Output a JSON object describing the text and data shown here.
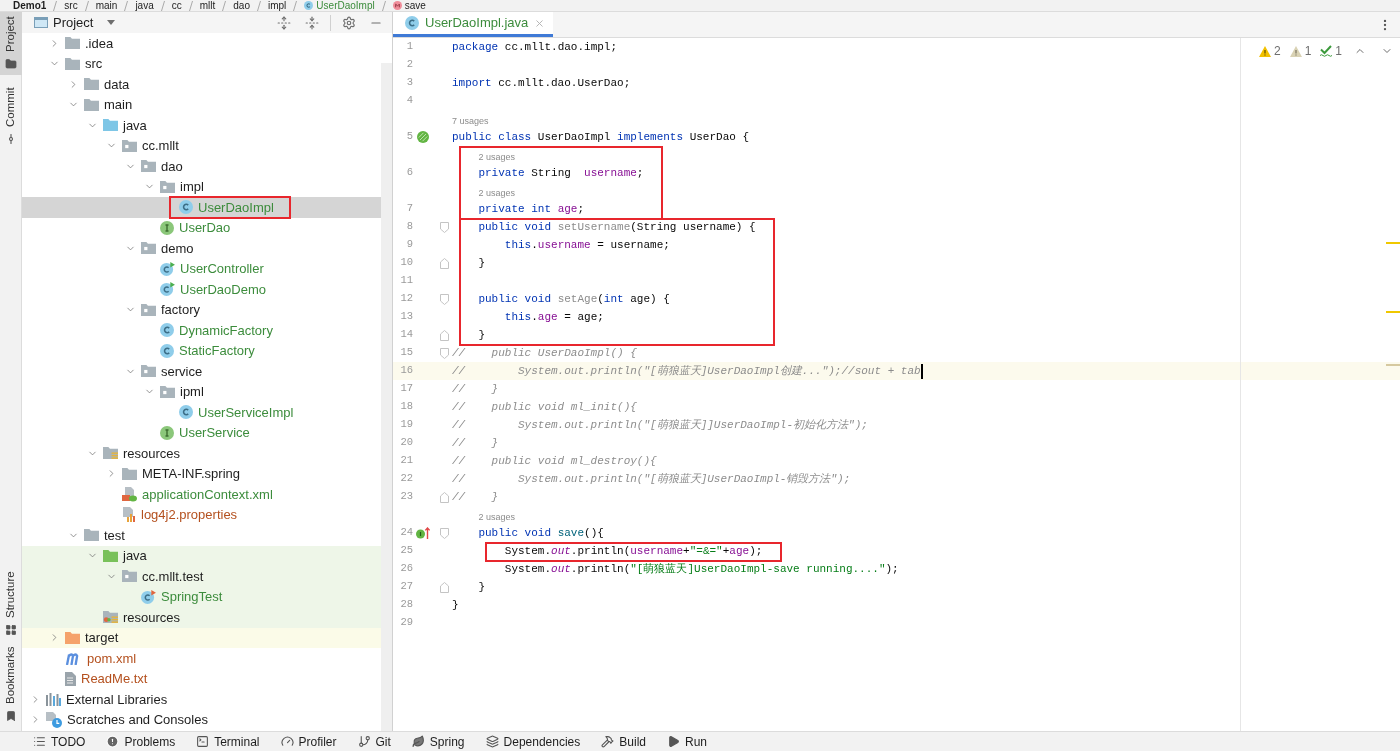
{
  "breadcrumb": [
    {
      "label": "Demo1",
      "kind": "project"
    },
    {
      "label": "src",
      "kind": "folder"
    },
    {
      "label": "main",
      "kind": "folder"
    },
    {
      "label": "java",
      "kind": "folder"
    },
    {
      "label": "cc",
      "kind": "folder"
    },
    {
      "label": "mllt",
      "kind": "folder"
    },
    {
      "label": "dao",
      "kind": "folder"
    },
    {
      "label": "impl",
      "kind": "folder"
    },
    {
      "label": "UserDaoImpl",
      "kind": "class",
      "color": "#3c8c3c"
    },
    {
      "label": "save",
      "kind": "method"
    }
  ],
  "tool_strip": {
    "top": [
      {
        "label": "Project",
        "kind": "folder",
        "selected": true
      },
      {
        "label": "Commit",
        "kind": "commit",
        "selected": false
      }
    ],
    "bottom": [
      {
        "label": "Structure",
        "kind": "structure",
        "selected": false
      },
      {
        "label": "Bookmarks",
        "kind": "bookmark",
        "selected": false
      }
    ]
  },
  "project_panel": {
    "title": "Project",
    "project_items": [
      {
        "label": ".idea",
        "kind": "folder",
        "expanded": false,
        "selected": false
      },
      {
        "label": "src",
        "kind": "folder",
        "expanded": true,
        "selected": false,
        "children": [
          {
            "label": "data",
            "kind": "folder",
            "expanded": false,
            "selected": false
          },
          {
            "label": "main",
            "kind": "folder",
            "expanded": true,
            "selected": false,
            "children": [
              {
                "label": "java",
                "kind": "source-folder",
                "expanded": true,
                "selected": false,
                "children": [
                  {
                    "label": "cc.mllt",
                    "kind": "package",
                    "expanded": true,
                    "selected": false,
                    "children": [
                      {
                        "label": "dao",
                        "kind": "package",
                        "expanded": true,
                        "selected": false,
                        "children": [
                          {
                            "label": "impl",
                            "kind": "package",
                            "expanded": true,
                            "selected": false,
                            "children": [
                              {
                                "label": "UserDaoImpl",
                                "kind": "class",
                                "color": "#3c8c3c",
                                "selected": true,
                                "framed": true
                              }
                            ]
                          },
                          {
                            "label": "UserDao",
                            "kind": "interface",
                            "color": "#3c8c3c",
                            "selected": false
                          }
                        ]
                      },
                      {
                        "label": "demo",
                        "kind": "package",
                        "expanded": true,
                        "selected": false,
                        "children": [
                          {
                            "label": "UserController",
                            "kind": "runnable-class",
                            "color": "#3c8c3c",
                            "selected": false
                          },
                          {
                            "label": "UserDaoDemo",
                            "kind": "runnable-class",
                            "color": "#3c8c3c",
                            "selected": false
                          }
                        ]
                      },
                      {
                        "label": "factory",
                        "kind": "package",
                        "expanded": true,
                        "selected": false,
                        "children": [
                          {
                            "label": "DynamicFactory",
                            "kind": "class",
                            "color": "#3c8c3c",
                            "selected": false
                          },
                          {
                            "label": "StaticFactory",
                            "kind": "class",
                            "color": "#3c8c3c",
                            "selected": false
                          }
                        ]
                      },
                      {
                        "label": "service",
                        "kind": "package",
                        "expanded": true,
                        "selected": false,
                        "children": [
                          {
                            "label": "ipml",
                            "kind": "package",
                            "expanded": true,
                            "selected": false,
                            "children": [
                              {
                                "label": "UserServiceImpl",
                                "kind": "class",
                                "color": "#3c8c3c",
                                "selected": false
                              }
                            ]
                          },
                          {
                            "label": "UserService",
                            "kind": "interface",
                            "color": "#3c8c3c",
                            "selected": false
                          }
                        ]
                      }
                    ]
                  }
                ]
              },
              {
                "label": "resources",
                "kind": "resources-folder",
                "expanded": true,
                "selected": false,
                "children": [
                  {
                    "label": "META-INF.spring",
                    "kind": "folder",
                    "expanded": false,
                    "selected": false
                  },
                  {
                    "label": "applicationContext.xml",
                    "kind": "spring-xml",
                    "color": "#3c8c3c",
                    "selected": false
                  },
                  {
                    "label": "log4j2.properties",
                    "kind": "properties",
                    "color": "#b4501e",
                    "selected": false
                  }
                ]
              }
            ]
          },
          {
            "label": "test",
            "kind": "folder",
            "expanded": true,
            "selected": false,
            "children": [
              {
                "label": "java",
                "kind": "test-source-folder",
                "expanded": true,
                "test_source": true,
                "selected": false,
                "children": [
                  {
                    "label": "cc.mllt.test",
                    "kind": "package",
                    "expanded": true,
                    "test_source": true,
                    "selected": false,
                    "children": [
                      {
                        "label": "SpringTest",
                        "kind": "test-class",
                        "color": "#3c8c3c",
                        "test_source": true,
                        "selected": false
                      }
                    ]
                  }
                ]
              },
              {
                "label": "resources",
                "kind": "test-resources-folder",
                "test_source": true,
                "selected": false
              }
            ]
          }
        ]
      },
      {
        "label": "target",
        "kind": "excluded-folder",
        "expanded": false,
        "excluded": true,
        "selected": false
      },
      {
        "label": "pom.xml",
        "kind": "maven",
        "color": "#b4501e",
        "selected": false
      },
      {
        "label": "ReadMe.txt",
        "kind": "text-file",
        "color": "#b4501e",
        "selected": false
      }
    ],
    "global_items": [
      {
        "label": "External Libraries",
        "kind": "libraries",
        "expanded": false,
        "selected": false
      },
      {
        "label": "Scratches and Consoles",
        "kind": "scratches",
        "expanded": false,
        "selected": false
      }
    ]
  },
  "editor": {
    "tabs": [
      {
        "label": "UserDaoImpl.java",
        "kind": "class",
        "color": "#3c8c3c",
        "selected": true
      }
    ],
    "inspections": [
      {
        "kind": "warning",
        "count": "2"
      },
      {
        "kind": "weak-warning",
        "count": "1"
      },
      {
        "kind": "typo",
        "count": "1"
      }
    ],
    "code": {
      "blocks": [
        {
          "framed": false,
          "lines": [
            {
              "number": "1",
              "current": false,
              "tokens": [
                {
                  "kind": "kw",
                  "text": "package"
                },
                {
                  "kind": "plain",
                  "text": " cc.mllt.dao.impl;"
                }
              ]
            },
            {
              "number": "2",
              "current": false
            },
            {
              "number": "3",
              "current": false,
              "tokens": [
                {
                  "kind": "kw",
                  "text": "import"
                },
                {
                  "kind": "plain",
                  "text": " cc.mllt.dao.UserDao;"
                }
              ]
            },
            {
              "number": "4",
              "current": false
            },
            {
              "number": "5",
              "current": false,
              "usages_hint": "7 usages",
              "gutter_marker": {
                "kind": "bean"
              },
              "tokens": [
                {
                  "kind": "kw",
                  "text": "public"
                },
                {
                  "kind": "kw",
                  "text": " class"
                },
                {
                  "kind": "plain",
                  "text": " UserDaoImpl "
                },
                {
                  "kind": "kw",
                  "text": "implements"
                },
                {
                  "kind": "plain",
                  "text": " UserDao {"
                }
              ]
            }
          ]
        },
        {
          "framed": true,
          "lines": [
            {
              "number": "6",
              "current": false,
              "usages_hint": "2 usages",
              "tokens": [
                {
                  "kind": "kw",
                  "text": "    private"
                },
                {
                  "kind": "plain",
                  "text": " String  "
                },
                {
                  "kind": "field",
                  "text": "username"
                },
                {
                  "kind": "plain",
                  "text": ";"
                }
              ]
            },
            {
              "number": "7",
              "current": false,
              "usages_hint": "2 usages",
              "tokens": [
                {
                  "kind": "kw",
                  "text": "    private"
                },
                {
                  "kind": "kw",
                  "text": " int"
                },
                {
                  "kind": "field",
                  "text": " age"
                },
                {
                  "kind": "plain",
                  "text": ";"
                }
              ]
            }
          ]
        },
        {
          "framed": true,
          "lines": [
            {
              "number": "8",
              "current": false,
              "fold_start": true,
              "tokens": [
                {
                  "kind": "kw",
                  "text": "    public"
                },
                {
                  "kind": "kw",
                  "text": " void"
                },
                {
                  "kind": "unused",
                  "text": " setUsername"
                },
                {
                  "kind": "plain",
                  "text": "(String username) {"
                }
              ]
            },
            {
              "number": "9",
              "current": false,
              "tokens": [
                {
                  "kind": "kw",
                  "text": "        this"
                },
                {
                  "kind": "plain",
                  "text": "."
                },
                {
                  "kind": "field",
                  "text": "username"
                },
                {
                  "kind": "plain",
                  "text": " = username;"
                }
              ]
            },
            {
              "number": "10",
              "current": false,
              "fold_end": true,
              "tokens": [
                {
                  "kind": "plain",
                  "text": "    }"
                }
              ]
            },
            {
              "number": "11",
              "current": false
            },
            {
              "number": "12",
              "current": false,
              "fold_start": true,
              "tokens": [
                {
                  "kind": "kw",
                  "text": "    public"
                },
                {
                  "kind": "kw",
                  "text": " void"
                },
                {
                  "kind": "unused",
                  "text": " setAge"
                },
                {
                  "kind": "plain",
                  "text": "("
                },
                {
                  "kind": "kw",
                  "text": "int"
                },
                {
                  "kind": "plain",
                  "text": " age) {"
                }
              ]
            },
            {
              "number": "13",
              "current": false,
              "tokens": [
                {
                  "kind": "kw",
                  "text": "        this"
                },
                {
                  "kind": "plain",
                  "text": "."
                },
                {
                  "kind": "field",
                  "text": "age"
                },
                {
                  "kind": "plain",
                  "text": " = age;"
                }
              ]
            },
            {
              "number": "14",
              "current": false,
              "fold_end": true,
              "tokens": [
                {
                  "kind": "plain",
                  "text": "    }"
                }
              ]
            }
          ]
        },
        {
          "framed": false,
          "lines": [
            {
              "number": "15",
              "current": false,
              "fold_start": true,
              "tokens": [
                {
                  "kind": "comment",
                  "text": "//    public UserDaoImpl() {"
                }
              ]
            },
            {
              "number": "16",
              "current": true,
              "tokens": [
                {
                  "kind": "comment",
                  "text": "//        System.out.println(\"[萌狼蓝天]UserDaoImpl创建...\");//sout + tab"
                }
              ]
            },
            {
              "number": "17",
              "current": false,
              "tokens": [
                {
                  "kind": "comment",
                  "text": "//    }"
                }
              ]
            },
            {
              "number": "18",
              "current": false,
              "tokens": [
                {
                  "kind": "comment",
                  "text": "//    public void ml_init(){"
                }
              ]
            },
            {
              "number": "19",
              "current": false,
              "tokens": [
                {
                  "kind": "comment",
                  "text": "//        System.out.println(\"[萌狼蓝天]]UserDaoImpl-初始化方法\");"
                }
              ]
            },
            {
              "number": "20",
              "current": false,
              "tokens": [
                {
                  "kind": "comment",
                  "text": "//    }"
                }
              ]
            },
            {
              "number": "21",
              "current": false,
              "tokens": [
                {
                  "kind": "comment",
                  "text": "//    public void ml_destroy(){"
                }
              ]
            },
            {
              "number": "22",
              "current": false,
              "tokens": [
                {
                  "kind": "comment",
                  "text": "//        System.out.println(\"[萌狼蓝天]UserDaoImpl-销毁方法\");"
                }
              ]
            },
            {
              "number": "23",
              "current": false,
              "fold_end": true,
              "tokens": [
                {
                  "kind": "comment",
                  "text": "//    }"
                }
              ]
            },
            {
              "number": "24",
              "current": false,
              "usages_hint": "2 usages",
              "gutter_marker": {
                "kind": "implements"
              },
              "fold_start": true,
              "tokens": [
                {
                  "kind": "kw",
                  "text": "    public"
                },
                {
                  "kind": "kw",
                  "text": " void"
                },
                {
                  "kind": "method",
                  "text": " save"
                },
                {
                  "kind": "plain",
                  "text": "(){"
                }
              ]
            }
          ]
        },
        {
          "framed": true,
          "lines": [
            {
              "number": "25",
              "current": false,
              "tokens": [
                {
                  "kind": "plain",
                  "text": "        System."
                },
                {
                  "kind": "static",
                  "text": "out"
                },
                {
                  "kind": "plain",
                  "text": ".println("
                },
                {
                  "kind": "field",
                  "text": "username"
                },
                {
                  "kind": "plain",
                  "text": "+"
                },
                {
                  "kind": "string",
                  "text": "\"=&=\""
                },
                {
                  "kind": "plain",
                  "text": "+"
                },
                {
                  "kind": "field",
                  "text": "age"
                },
                {
                  "kind": "plain",
                  "text": ");"
                }
              ]
            }
          ]
        },
        {
          "framed": false,
          "lines": [
            {
              "number": "26",
              "current": false,
              "tokens": [
                {
                  "kind": "plain",
                  "text": "        System."
                },
                {
                  "kind": "static",
                  "text": "out"
                },
                {
                  "kind": "plain",
                  "text": ".println("
                },
                {
                  "kind": "string",
                  "text": "\"[萌狼蓝天]UserDaoImpl-save running....\""
                },
                {
                  "kind": "plain",
                  "text": ");"
                }
              ]
            },
            {
              "number": "27",
              "current": false,
              "fold_end": true,
              "tokens": [
                {
                  "kind": "plain",
                  "text": "    }"
                }
              ]
            },
            {
              "number": "28",
              "current": false,
              "tokens": [
                {
                  "kind": "plain",
                  "text": "}"
                }
              ]
            },
            {
              "number": "29",
              "current": false
            }
          ]
        }
      ]
    }
  },
  "bottom_bar": [
    {
      "label": "TODO",
      "kind": "list",
      "selected": false
    },
    {
      "label": "Problems",
      "kind": "problems",
      "selected": false
    },
    {
      "label": "Terminal",
      "kind": "terminal",
      "selected": false
    },
    {
      "label": "Profiler",
      "kind": "profiler",
      "selected": false
    },
    {
      "label": "Git",
      "kind": "git",
      "selected": false
    },
    {
      "label": "Spring",
      "kind": "spring",
      "selected": false
    },
    {
      "label": "Dependencies",
      "kind": "dependencies",
      "selected": false
    },
    {
      "label": "Build",
      "kind": "build",
      "selected": false
    },
    {
      "label": "Run",
      "kind": "run",
      "selected": false
    }
  ]
}
